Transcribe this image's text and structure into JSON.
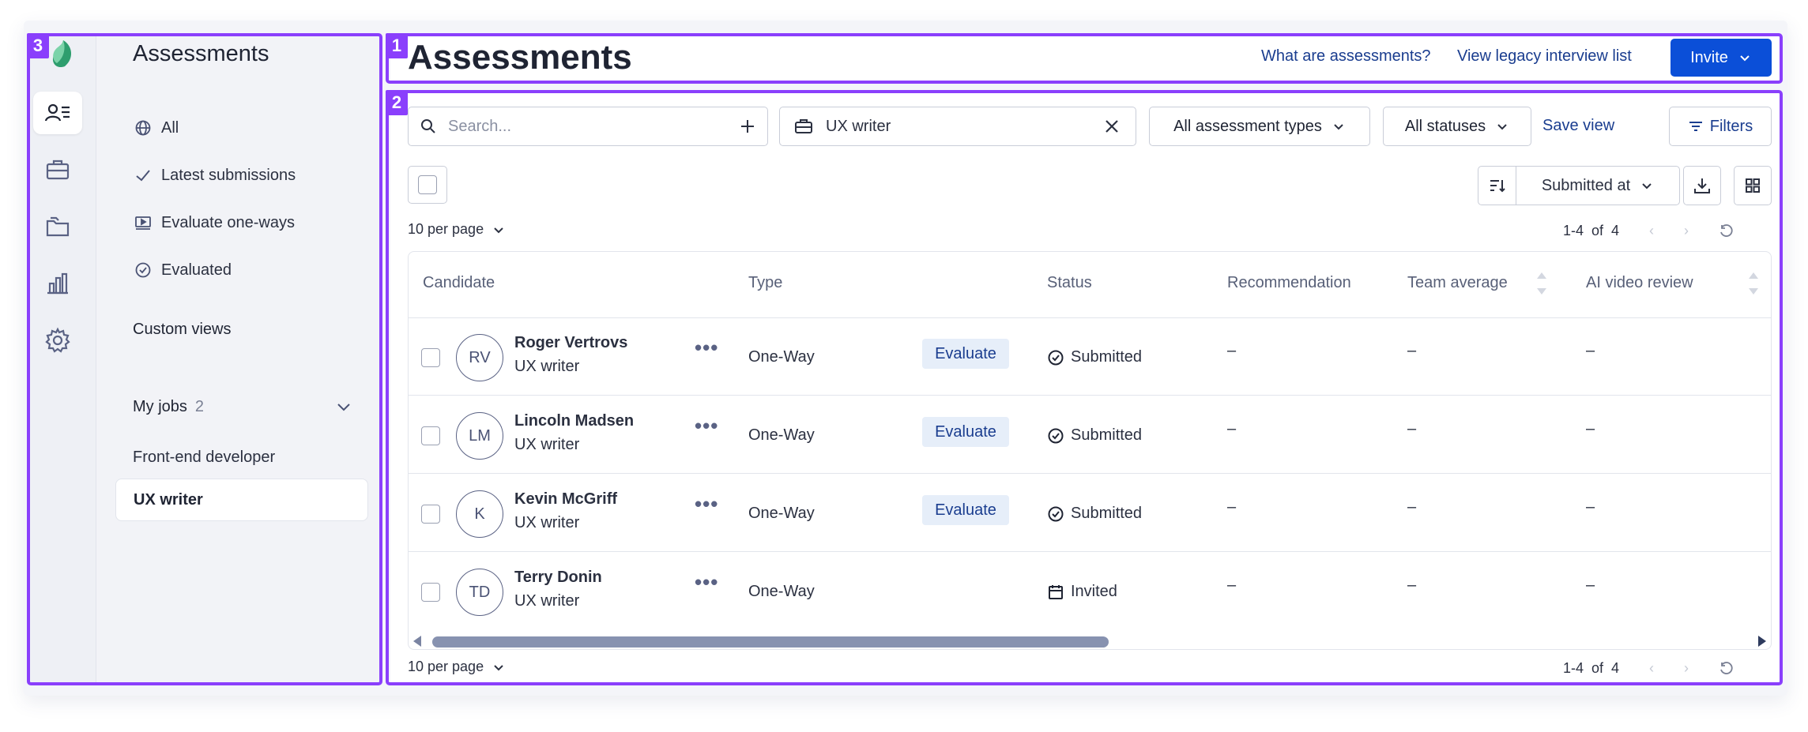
{
  "annotations": {
    "header": "1",
    "main": "2",
    "sidebar": "3"
  },
  "colors": {
    "accent": "#0b4fd8",
    "link": "#1a3d8f",
    "annotation": "#8a3ffc",
    "logo": "#2e9e6e"
  },
  "sidebar": {
    "rail": [
      {
        "name": "candidates-icon",
        "active": true
      },
      {
        "name": "briefcase-icon",
        "active": false
      },
      {
        "name": "folders-icon",
        "active": false
      },
      {
        "name": "bar-chart-icon",
        "active": false
      },
      {
        "name": "gear-icon",
        "active": false
      }
    ],
    "title": "Assessments",
    "items": [
      {
        "label": "All",
        "icon": "globe-icon"
      },
      {
        "label": "Latest submissions",
        "icon": "check-icon"
      },
      {
        "label": "Evaluate one-ways",
        "icon": "video-icon"
      },
      {
        "label": "Evaluated",
        "icon": "check-circle-icon"
      }
    ],
    "custom_views": "Custom views",
    "my_jobs": {
      "label": "My jobs",
      "count": "2"
    },
    "jobs": [
      {
        "label": "Front-end developer",
        "active": false
      },
      {
        "label": "UX writer",
        "active": true
      }
    ]
  },
  "header": {
    "title": "Assessments",
    "link_what": "What are assessments?",
    "link_legacy": "View legacy interview list",
    "invite": "Invite"
  },
  "toolbar": {
    "search_placeholder": "Search...",
    "job_filter": "UX writer",
    "type_filter": "All assessment types",
    "status_filter": "All statuses",
    "save_view": "Save view",
    "filters": "Filters",
    "sort_label": "Submitted at"
  },
  "pagination": {
    "per_page": "10 per page",
    "range": "1-4",
    "of": "of",
    "total": "4"
  },
  "table": {
    "columns": {
      "candidate": "Candidate",
      "type": "Type",
      "status": "Status",
      "recommendation": "Recommendation",
      "team_average": "Team average",
      "ai_video_review": "AI video review"
    },
    "rows": [
      {
        "initials": "RV",
        "name": "Roger Vertrovs",
        "job": "UX writer",
        "type": "One-Way",
        "action": "Evaluate",
        "status": "Submitted",
        "status_icon": "check-circle-icon",
        "recommendation": "–",
        "team_average": "–",
        "ai_review": "–"
      },
      {
        "initials": "LM",
        "name": "Lincoln Madsen",
        "job": "UX writer",
        "type": "One-Way",
        "action": "Evaluate",
        "status": "Submitted",
        "status_icon": "check-circle-icon",
        "recommendation": "–",
        "team_average": "–",
        "ai_review": "–"
      },
      {
        "initials": "K",
        "name": "Kevin McGriff",
        "job": "UX writer",
        "type": "One-Way",
        "action": "Evaluate",
        "status": "Submitted",
        "status_icon": "check-circle-icon",
        "recommendation": "–",
        "team_average": "–",
        "ai_review": "–"
      },
      {
        "initials": "TD",
        "name": "Terry Donin",
        "job": "UX writer",
        "type": "One-Way",
        "action": "",
        "status": "Invited",
        "status_icon": "calendar-icon",
        "recommendation": "–",
        "team_average": "–",
        "ai_review": "–"
      }
    ]
  }
}
